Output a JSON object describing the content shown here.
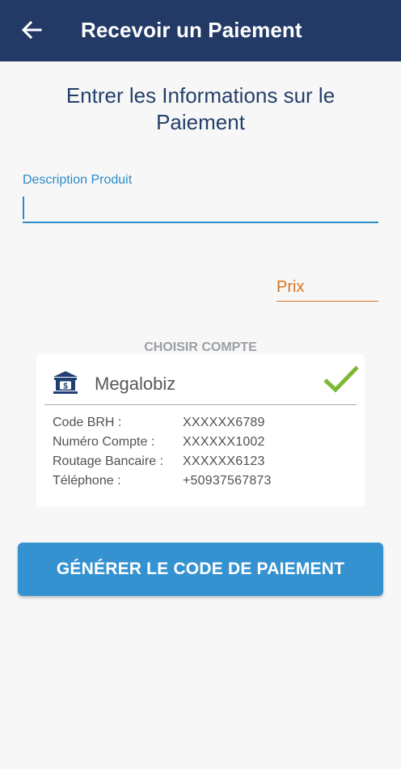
{
  "app_bar": {
    "title": "Recevoir un Paiement",
    "back_icon": "arrow-left-icon",
    "background": "#233a67"
  },
  "form": {
    "title": "Entrer les Informations sur le Paiement",
    "description": {
      "label": "Description Produit",
      "value": ""
    },
    "price": {
      "placeholder": "Prix",
      "value": ""
    }
  },
  "account_section": {
    "label": "CHOISIR COMPTE",
    "account": {
      "name": "Megalobiz",
      "bank_icon": "bank-icon",
      "selected_icon": "checkmark-icon",
      "details": [
        {
          "label": "Code BRH :",
          "value": "XXXXXX6789"
        },
        {
          "label": "Numéro Compte :",
          "value": "XXXXXX1002"
        },
        {
          "label": "Routage Bancaire :",
          "value": "XXXXXX6123"
        },
        {
          "label": "Téléphone :",
          "value": "+50937567873"
        }
      ]
    }
  },
  "actions": {
    "generate_label": "GÉNÉRER LE CODE DE PAIEMENT"
  },
  "colors": {
    "accent_blue": "#2a8cc9",
    "accent_orange": "#d9731f",
    "button_blue": "#3592d1",
    "check_green": "#7cb933",
    "title_navy": "#23406a"
  }
}
